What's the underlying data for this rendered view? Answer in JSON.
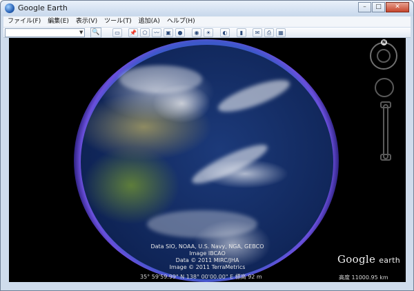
{
  "window": {
    "title": "Google Earth"
  },
  "menu": [
    "ファイル(F)",
    "編集(E)",
    "表示(V)",
    "ツール(T)",
    "追加(A)",
    "ヘルプ(H)"
  ],
  "search": {
    "value": "",
    "placeholder": ""
  },
  "toolbar": {
    "icons": [
      "sidebar-icon",
      "placemark-icon",
      "polygon-icon",
      "path-icon",
      "overlay-icon",
      "tour-icon",
      "sky-icon",
      "sun-icon",
      "planet-icon",
      "ruler-icon",
      "email-icon",
      "print-icon",
      "maps-icon"
    ]
  },
  "attribution": {
    "line1": "Data SIO, NOAA, U.S. Navy, NGA, GEBCO",
    "line2": "Image IBCAO",
    "line3": "Data © 2011 MIRC/JHA",
    "line4": "Image © 2011 TerraMetrics"
  },
  "logo": {
    "google": "Google",
    "earth": "earth"
  },
  "status": {
    "coords": "35° 59'59.99\" N 138° 00'00.00\" E  標高   92 m",
    "altitude": "高度  11000.95 km"
  },
  "nav": {
    "north_label": "N"
  }
}
